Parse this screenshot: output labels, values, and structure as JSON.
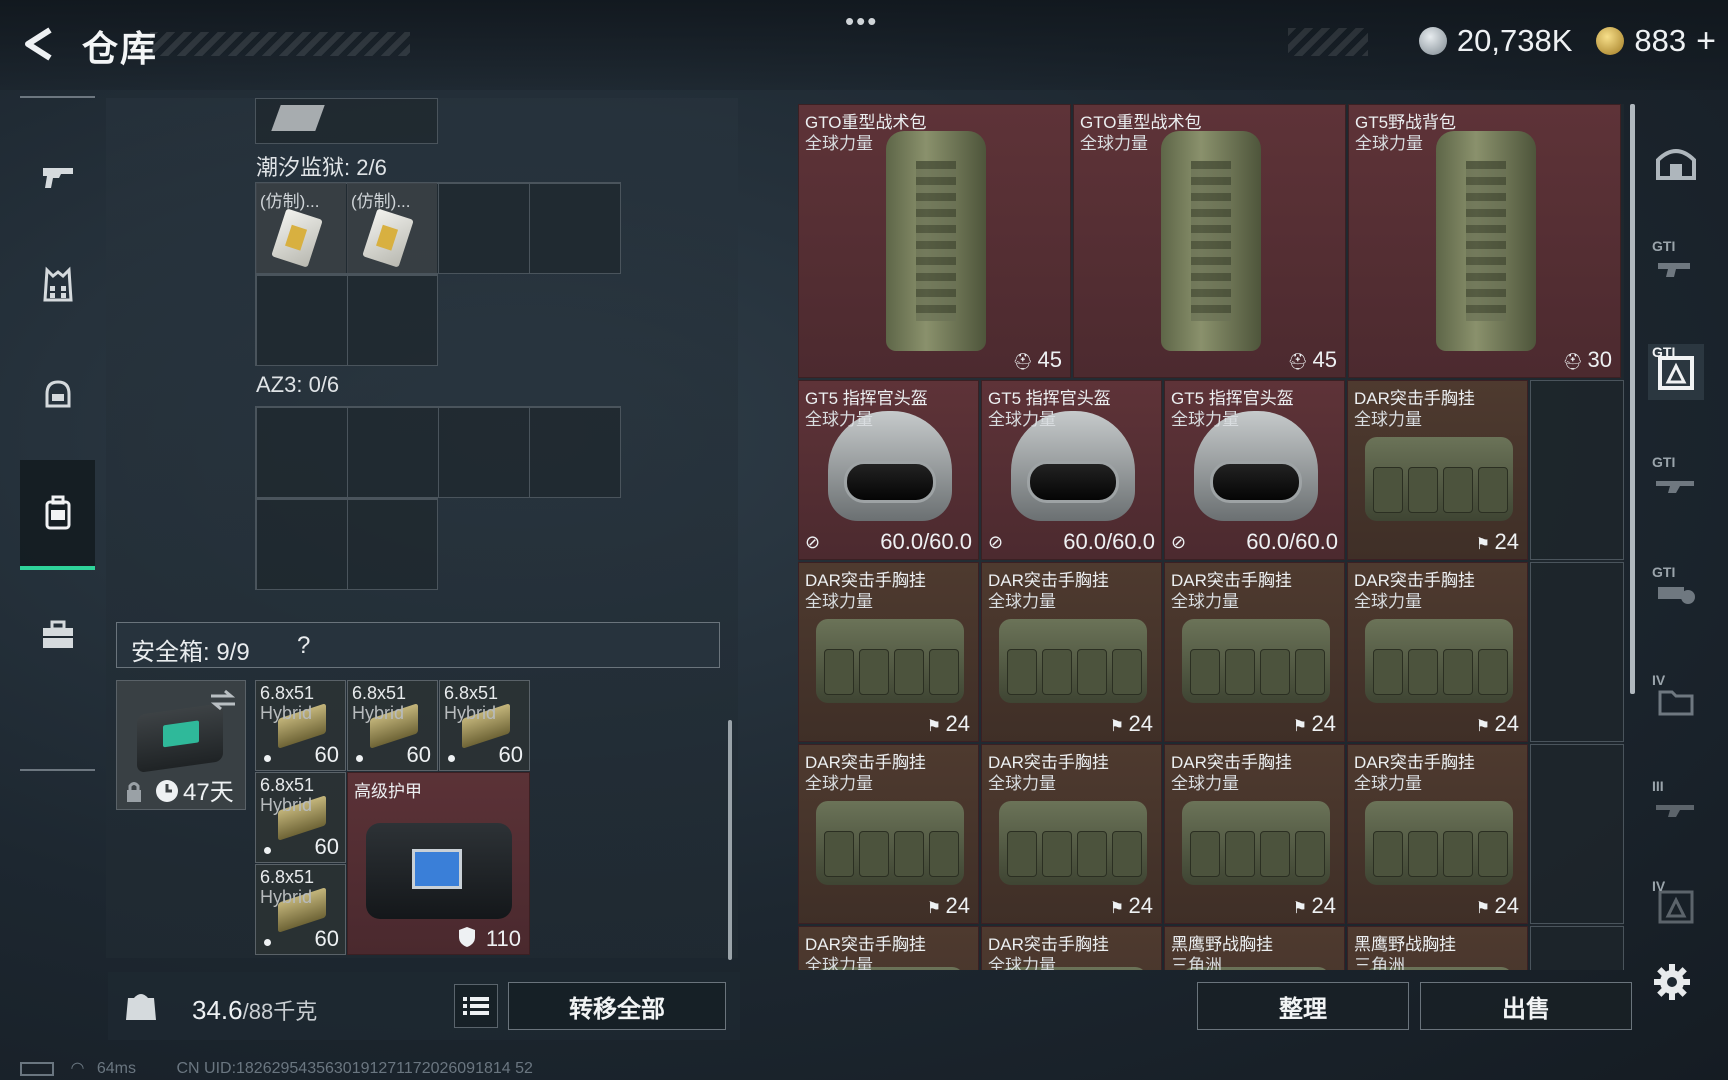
{
  "header": {
    "title": "仓库",
    "more": "•••",
    "currencies": [
      {
        "icon": "silver-coin-icon",
        "amount": "20,738K"
      },
      {
        "icon": "gold-coin-icon",
        "amount": "883"
      }
    ],
    "plus": "+"
  },
  "left_nav": {
    "items": [
      {
        "name": "weapons",
        "icon": "pistol-icon"
      },
      {
        "name": "armor",
        "icon": "vest-icon"
      },
      {
        "name": "helmet",
        "icon": "helmet-icon"
      },
      {
        "name": "backpack",
        "icon": "backpack-icon",
        "active": true
      },
      {
        "name": "items",
        "icon": "toolbox-icon"
      }
    ]
  },
  "inventory": {
    "sections": [
      {
        "label": "潮汐监狱: 2/6",
        "items": [
          {
            "tag": "(仿制)..."
          },
          {
            "tag": "(仿制)..."
          }
        ]
      },
      {
        "label": "AZ3: 0/6",
        "items": []
      }
    ],
    "safe_box": {
      "title": "安全箱:  9/9",
      "help": "?",
      "days": "47天",
      "ammo": [
        {
          "name": "6.8x51",
          "sub": "Hybrid",
          "qty": "60"
        },
        {
          "name": "6.8x51",
          "sub": "Hybrid",
          "qty": "60"
        },
        {
          "name": "6.8x51",
          "sub": "Hybrid",
          "qty": "60"
        },
        {
          "name": "6.8x51",
          "sub": "Hybrid",
          "qty": "60"
        },
        {
          "name": "6.8x51",
          "sub": "Hybrid",
          "qty": "60"
        }
      ],
      "armor_item": {
        "name": "高级护甲",
        "value": "110"
      }
    },
    "weight": {
      "current": "34.6",
      "max": "/88千克"
    },
    "transfer_all": "转移全部"
  },
  "storage": {
    "rows": [
      [
        {
          "name": "GTO重型战术包",
          "sub": "全球力量",
          "capacity": "45",
          "kind": "backpack"
        },
        {
          "name": "GTO重型战术包",
          "sub": "全球力量",
          "capacity": "45",
          "kind": "backpack"
        },
        {
          "name": "GT5野战背包",
          "sub": "全球力量",
          "capacity": "30",
          "kind": "backpack"
        }
      ],
      [
        {
          "name": "GT5 指挥官头盔",
          "sub": "全球力量",
          "durability": "60.0/60.0",
          "kind": "helmet"
        },
        {
          "name": "GT5 指挥官头盔",
          "sub": "全球力量",
          "durability": "60.0/60.0",
          "kind": "helmet"
        },
        {
          "name": "GT5 指挥官头盔",
          "sub": "全球力量",
          "durability": "60.0/60.0",
          "kind": "helmet"
        },
        {
          "name": "DAR突击手胸挂",
          "sub": "全球力量",
          "capacity": "24",
          "kind": "rig"
        }
      ],
      [
        {
          "name": "DAR突击手胸挂",
          "sub": "全球力量",
          "capacity": "24",
          "kind": "rig"
        },
        {
          "name": "DAR突击手胸挂",
          "sub": "全球力量",
          "capacity": "24",
          "kind": "rig"
        },
        {
          "name": "DAR突击手胸挂",
          "sub": "全球力量",
          "capacity": "24",
          "kind": "rig"
        },
        {
          "name": "DAR突击手胸挂",
          "sub": "全球力量",
          "capacity": "24",
          "kind": "rig"
        }
      ],
      [
        {
          "name": "DAR突击手胸挂",
          "sub": "全球力量",
          "capacity": "24",
          "kind": "rig"
        },
        {
          "name": "DAR突击手胸挂",
          "sub": "全球力量",
          "capacity": "24",
          "kind": "rig"
        },
        {
          "name": "DAR突击手胸挂",
          "sub": "全球力量",
          "capacity": "24",
          "kind": "rig"
        },
        {
          "name": "DAR突击手胸挂",
          "sub": "全球力量",
          "capacity": "24",
          "kind": "rig"
        }
      ],
      [
        {
          "name": "DAR突击手胸挂",
          "sub": "全球力量",
          "kind": "rig"
        },
        {
          "name": "DAR突击手胸挂",
          "sub": "全球力量",
          "kind": "rig"
        },
        {
          "name": "黑鹰野战胸挂",
          "sub": "三角洲",
          "kind": "rig"
        },
        {
          "name": "黑鹰野战胸挂",
          "sub": "三角洲",
          "kind": "rig"
        }
      ]
    ],
    "sort_label": "整理",
    "sell_label": "出售"
  },
  "right_rail": {
    "items": [
      {
        "label": "",
        "icon": "bunker-icon"
      },
      {
        "label": "GTI",
        "icon": "gti-weapon-icon"
      },
      {
        "label": "GTI",
        "icon": "gti-gear-icon",
        "active": true
      },
      {
        "label": "GTI",
        "icon": "gti-rifle-icon"
      },
      {
        "label": "GTI",
        "icon": "gti-scope-icon"
      },
      {
        "label": "IV",
        "icon": "tier4-folder-icon"
      },
      {
        "label": "III",
        "icon": "tier3-rifle-icon"
      },
      {
        "label": "IV",
        "icon": "tier4-gear-icon"
      }
    ]
  },
  "status": {
    "ping": "64ms",
    "uid": "CN UID:1826295435630191271172026091814 52"
  }
}
